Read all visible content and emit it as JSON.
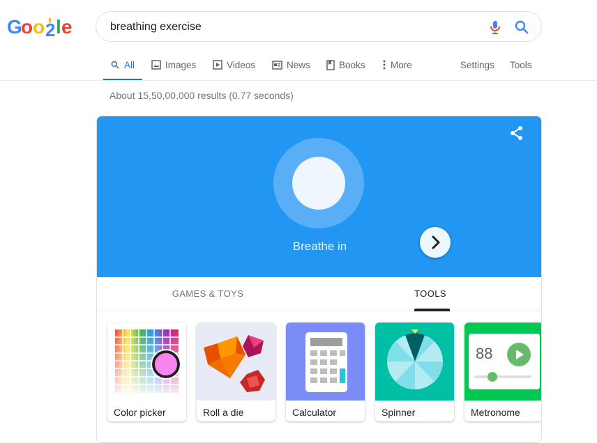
{
  "logo": {
    "text": "Google",
    "colors": [
      "#4285f4",
      "#ea4335",
      "#fbbc05",
      "#4285f4",
      "#34a853",
      "#ea4335"
    ]
  },
  "search": {
    "query": "breathing exercise"
  },
  "nav": {
    "items": [
      {
        "label": "All",
        "icon": "search-icon",
        "active": true
      },
      {
        "label": "Images",
        "icon": "image-icon"
      },
      {
        "label": "Videos",
        "icon": "video-icon"
      },
      {
        "label": "News",
        "icon": "news-icon"
      },
      {
        "label": "Books",
        "icon": "book-icon"
      },
      {
        "label": "More",
        "icon": "more-vert-icon"
      },
      {
        "label": "Settings"
      },
      {
        "label": "Tools"
      }
    ]
  },
  "results": {
    "count_text": "About 15,50,00,000 results (0.77 seconds)"
  },
  "breathing": {
    "instruction": "Breathe in",
    "color": "#2196f3",
    "share_icon": "share-icon"
  },
  "tabs": [
    {
      "label": "GAMES & TOYS"
    },
    {
      "label": "TOOLS",
      "active": true
    }
  ],
  "tools": [
    {
      "label": "Color picker",
      "icon": "color-picker-icon"
    },
    {
      "label": "Roll a die",
      "icon": "dice-icon"
    },
    {
      "label": "Calculator",
      "icon": "calculator-icon"
    },
    {
      "label": "Spinner",
      "icon": "spinner-icon"
    },
    {
      "label": "Metronome",
      "icon": "metronome-icon",
      "bpm": "88"
    }
  ],
  "carousel": {
    "next_icon": "chevron-right-icon"
  }
}
